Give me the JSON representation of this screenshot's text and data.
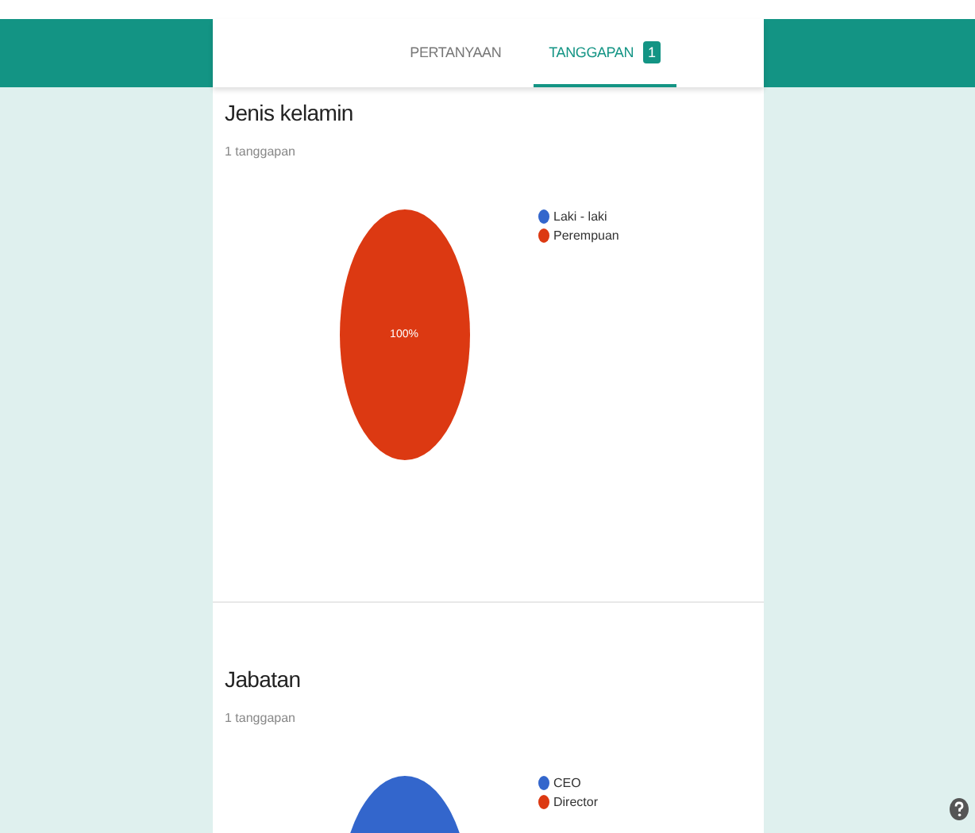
{
  "tabs": [
    {
      "label": "PERTANYAAN",
      "selected": false
    },
    {
      "label": "TANGGAPAN",
      "selected": true,
      "badge": "1"
    }
  ],
  "sections": [
    {
      "title": "Jenis kelamin",
      "subtitle": "1 tanggapan",
      "chart_data": {
        "type": "pie",
        "categories": [
          "Laki - laki",
          "Perempuan"
        ],
        "colors": [
          "#3366cc",
          "#dc3912"
        ],
        "values": [
          0,
          100
        ],
        "value_labels": [
          null,
          "100%"
        ]
      }
    },
    {
      "title": "Jabatan",
      "subtitle": "1 tanggapan",
      "chart_data": {
        "type": "pie",
        "categories": [
          "CEO",
          "Director"
        ],
        "colors": [
          "#3366cc",
          "#dc3912"
        ],
        "values": [
          100,
          0
        ]
      }
    }
  ]
}
